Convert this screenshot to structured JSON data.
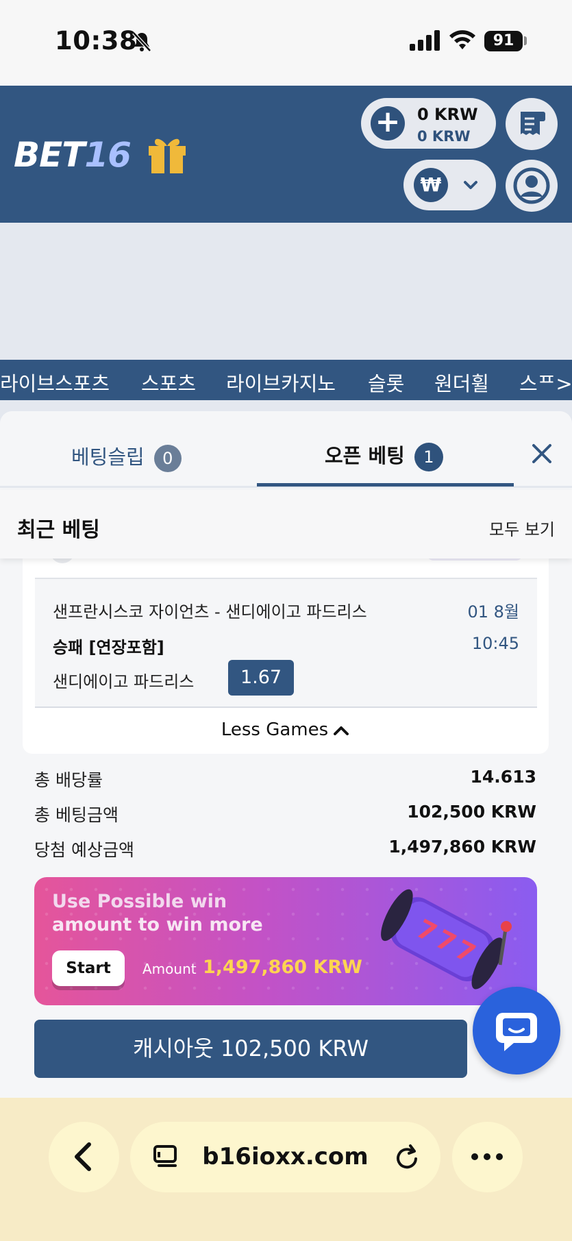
{
  "status_bar": {
    "time": "10:38",
    "battery": "91"
  },
  "header": {
    "logo_text": "BET",
    "logo_num": "16",
    "balance_main": "0 KRW",
    "balance_bonus": "0 KRW",
    "currency_symbol": "₩"
  },
  "nav": {
    "items": [
      "라이브스포츠",
      "스포츠",
      "라이브카지노",
      "슬롯",
      "원더휠",
      "스ᄑ>ᄑ"
    ]
  },
  "betslip": {
    "tab_betslip": "베팅슬립",
    "tab_betslip_count": "0",
    "tab_open": "오픈 베팅",
    "tab_open_count": "1",
    "recent_title": "최근 베팅",
    "see_all": "모두 보기",
    "game": {
      "match": "샌프란시스코 자이언츠 - 샌디에이고 파드리스",
      "date": "01 8월",
      "market": "승패 [연장포함]",
      "time": "10:45",
      "pick": "샌디에이고 파드리스",
      "odd": "1.67"
    },
    "less_games": "Less Games",
    "summary": [
      {
        "label": "총 배당률",
        "value": "14.613"
      },
      {
        "label": "총 베팅금액",
        "value": "102,500 KRW"
      },
      {
        "label": "당첨 예상금액",
        "value": "1,497,860 KRW"
      }
    ],
    "promo": {
      "line1": "Use Possible win",
      "line2": "amount to win more",
      "start_label": "Start",
      "amount_label": "Amount",
      "amount_value": "1,497,860 KRW"
    },
    "cashout_label": "캐시아웃 102,500 KRW"
  },
  "browser": {
    "domain": "b16ioxx.com"
  },
  "colors": {
    "brand": "#325681",
    "accent_yellow": "#ffd451",
    "chat": "#2a62dc"
  }
}
